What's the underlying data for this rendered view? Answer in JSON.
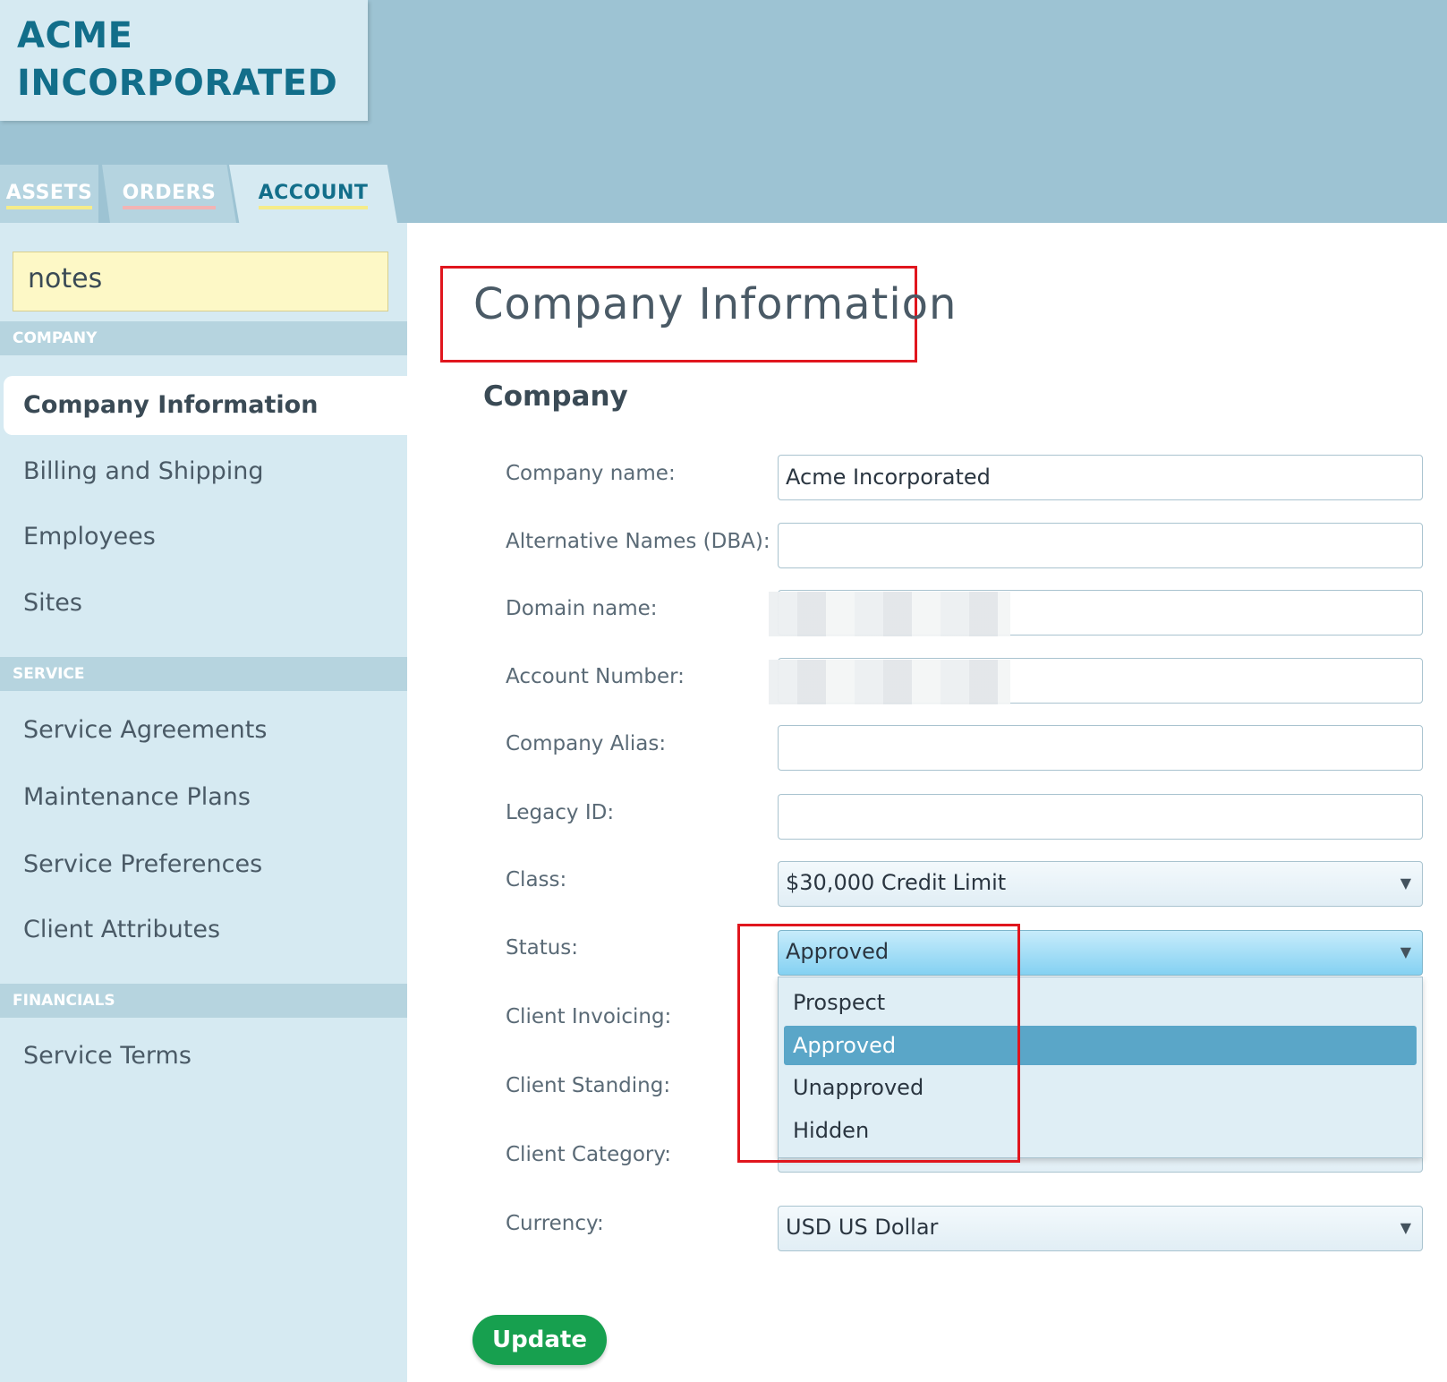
{
  "brand": {
    "line1": "ACME",
    "line2": "INCORPORATED"
  },
  "tabs": [
    {
      "label": "ASSETS"
    },
    {
      "label": "ORDERS"
    },
    {
      "label": "ACCOUNT"
    }
  ],
  "notes": {
    "label": "notes"
  },
  "sidebar": {
    "sections": [
      {
        "heading": "COMPANY",
        "items": [
          "Company Information",
          "Billing and Shipping",
          "Employees",
          "Sites"
        ]
      },
      {
        "heading": "SERVICE",
        "items": [
          "Service Agreements",
          "Maintenance Plans",
          "Service Preferences",
          "Client Attributes"
        ]
      },
      {
        "heading": "FINANCIALS",
        "items": [
          "Service Terms"
        ]
      }
    ],
    "active": "Company Information"
  },
  "page": {
    "title": "Company Information",
    "section": "Company"
  },
  "form": {
    "company_name": {
      "label": "Company name:",
      "value": "Acme Incorporated"
    },
    "alt_names": {
      "label": "Alternative Names (DBA):",
      "value": ""
    },
    "domain_name": {
      "label": "Domain name:",
      "value": ""
    },
    "account_number": {
      "label": "Account Number:",
      "value": ""
    },
    "company_alias": {
      "label": "Company Alias:",
      "value": ""
    },
    "legacy_id": {
      "label": "Legacy ID:",
      "value": ""
    },
    "class": {
      "label": "Class:",
      "value": "$30,000 Credit Limit"
    },
    "status": {
      "label": "Status:",
      "value": "Approved",
      "options": [
        "Prospect",
        "Approved",
        "Unapproved",
        "Hidden"
      ],
      "selected_index": 1
    },
    "client_invoicing": {
      "label": "Client Invoicing:"
    },
    "client_standing": {
      "label": "Client Standing:"
    },
    "client_category": {
      "label": "Client Category:"
    },
    "currency": {
      "label": "Currency:",
      "value": "USD US Dollar"
    }
  },
  "actions": {
    "update": "Update"
  },
  "icons": {
    "caret": "chevron-down-icon"
  },
  "colors": {
    "brand": "#126e8a",
    "update": "#17a04f",
    "highlight": "#e0161e",
    "selected_option": "#5aa6c8"
  }
}
